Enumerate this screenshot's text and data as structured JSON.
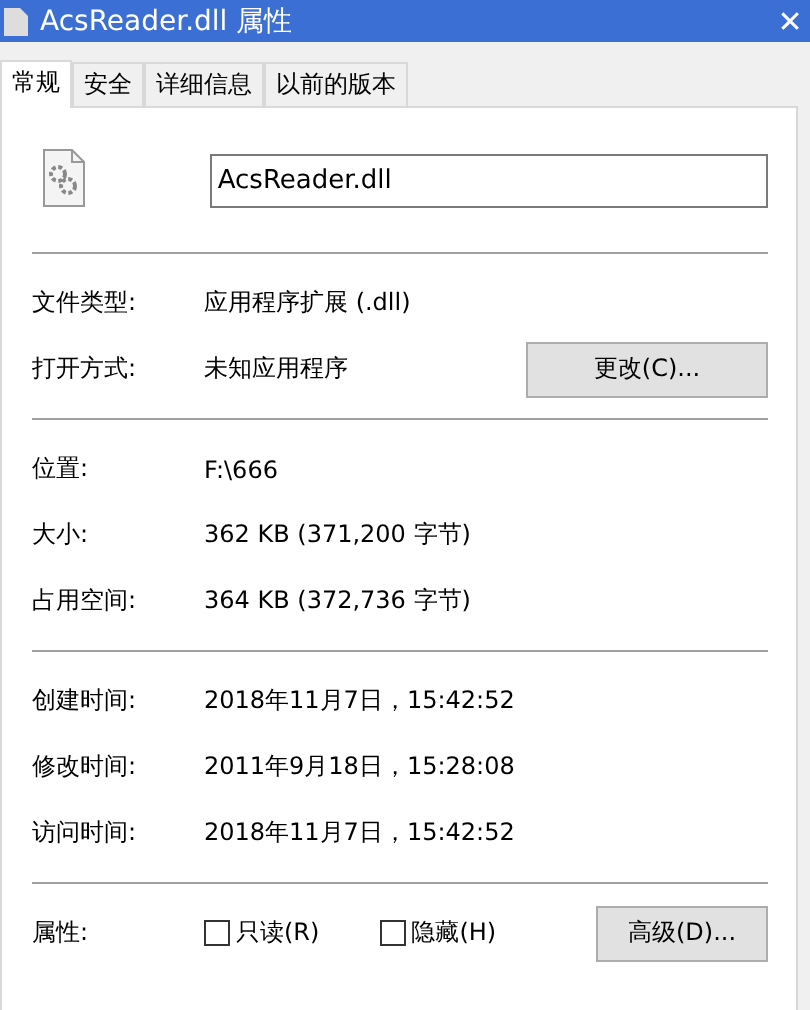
{
  "window": {
    "title": "AcsReader.dll 属性",
    "close": "✕"
  },
  "tabs": [
    {
      "label": "常规",
      "selected": true
    },
    {
      "label": "安全",
      "selected": false
    },
    {
      "label": "详细信息",
      "selected": false
    },
    {
      "label": "以前的版本",
      "selected": false
    }
  ],
  "file_name": "AcsReader.dll",
  "sections": [
    [
      {
        "label": "文件类型:",
        "value": "应用程序扩展 (.dll)"
      },
      {
        "label": "打开方式:",
        "value": "未知应用程序",
        "button": "更改(C)..."
      }
    ],
    [
      {
        "label": "位置:",
        "value": "F:\\666"
      },
      {
        "label": "大小:",
        "value": "362 KB (371,200 字节)"
      },
      {
        "label": "占用空间:",
        "value": "364 KB (372,736 字节)"
      }
    ],
    [
      {
        "label": "创建时间:",
        "value": "2018年11月7日，15:42:52"
      },
      {
        "label": "修改时间:",
        "value": "2011年9月18日，15:28:08"
      },
      {
        "label": "访问时间:",
        "value": "2018年11月7日，15:42:52"
      }
    ]
  ],
  "attributes": {
    "label": "属性:",
    "checkboxes": [
      {
        "label": "只读(R)",
        "checked": false
      },
      {
        "label": "隐藏(H)",
        "checked": false
      }
    ],
    "button": "高级(D)..."
  }
}
